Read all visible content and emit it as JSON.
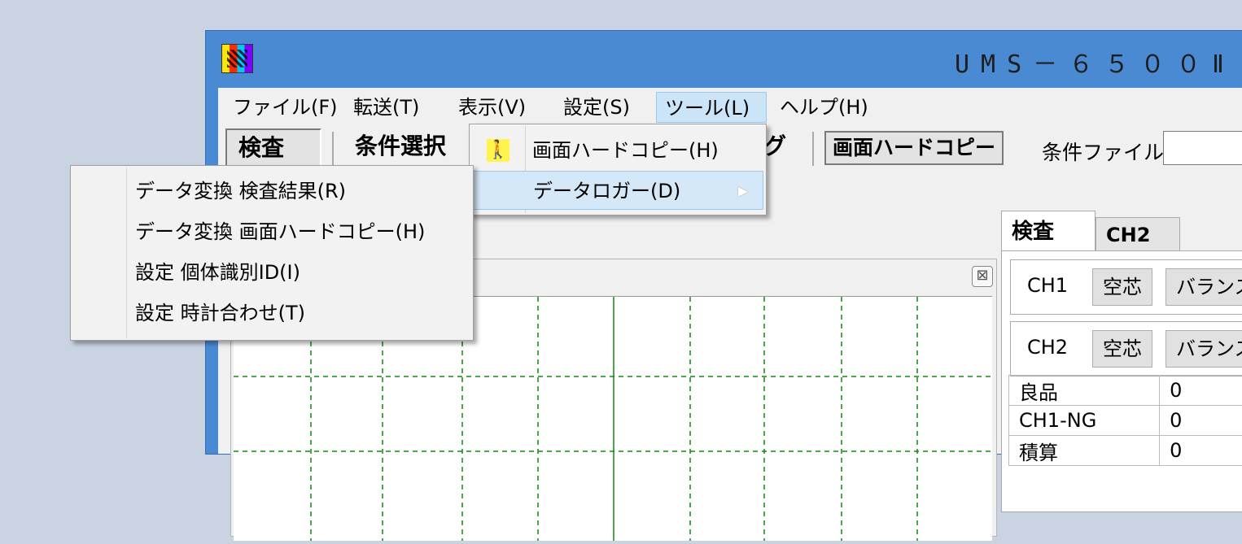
{
  "window": {
    "title": "UMS－６５００Ⅱ"
  },
  "menubar": {
    "items": [
      {
        "label": "ファイル(F)"
      },
      {
        "label": "転送(T)"
      },
      {
        "label": "表示(V)"
      },
      {
        "label": "設定(S)"
      },
      {
        "label": "ツール(L)"
      },
      {
        "label": "ヘルプ(H)"
      }
    ]
  },
  "toolbar": {
    "inspect": "検査",
    "condition_select": "条件選択",
    "fragment": "グ",
    "screen_hardcopy": "画面ハードコピー",
    "condition_file_label": "条件ファイル",
    "condition_file_value": ""
  },
  "tools_menu": {
    "items": [
      {
        "label": "画面ハードコピー(H)",
        "icon": "walking-person-icon"
      },
      {
        "label": "データロガー(D)",
        "submenu_arrow": "▶"
      }
    ]
  },
  "logger_submenu": {
    "items": [
      {
        "label": "データ変換 検査結果(R)"
      },
      {
        "label": "データ変換 画面ハードコピー(H)"
      },
      {
        "label": "設定 個体識別ID(I)"
      },
      {
        "label": "設定 時計合わせ(T)"
      }
    ]
  },
  "graph": {
    "close_glyph": "⊠",
    "grid_color": "#118811"
  },
  "right_panel": {
    "tabs": [
      {
        "label": "検査"
      },
      {
        "label": "CH2"
      }
    ],
    "channels": [
      {
        "label": "CH1",
        "btn1": "空芯",
        "btn2": "バランス"
      },
      {
        "label": "CH2",
        "btn1": "空芯",
        "btn2": "バランス"
      }
    ],
    "counts": [
      {
        "name": "良品",
        "value": "0"
      },
      {
        "name": "CH1-NG",
        "value": "0"
      },
      {
        "name": "積算",
        "value": "0"
      }
    ]
  },
  "colors": {
    "title_bar": "#4a8ad2",
    "menu_highlight": "#cce4f7",
    "background": "#c9d3e1"
  }
}
